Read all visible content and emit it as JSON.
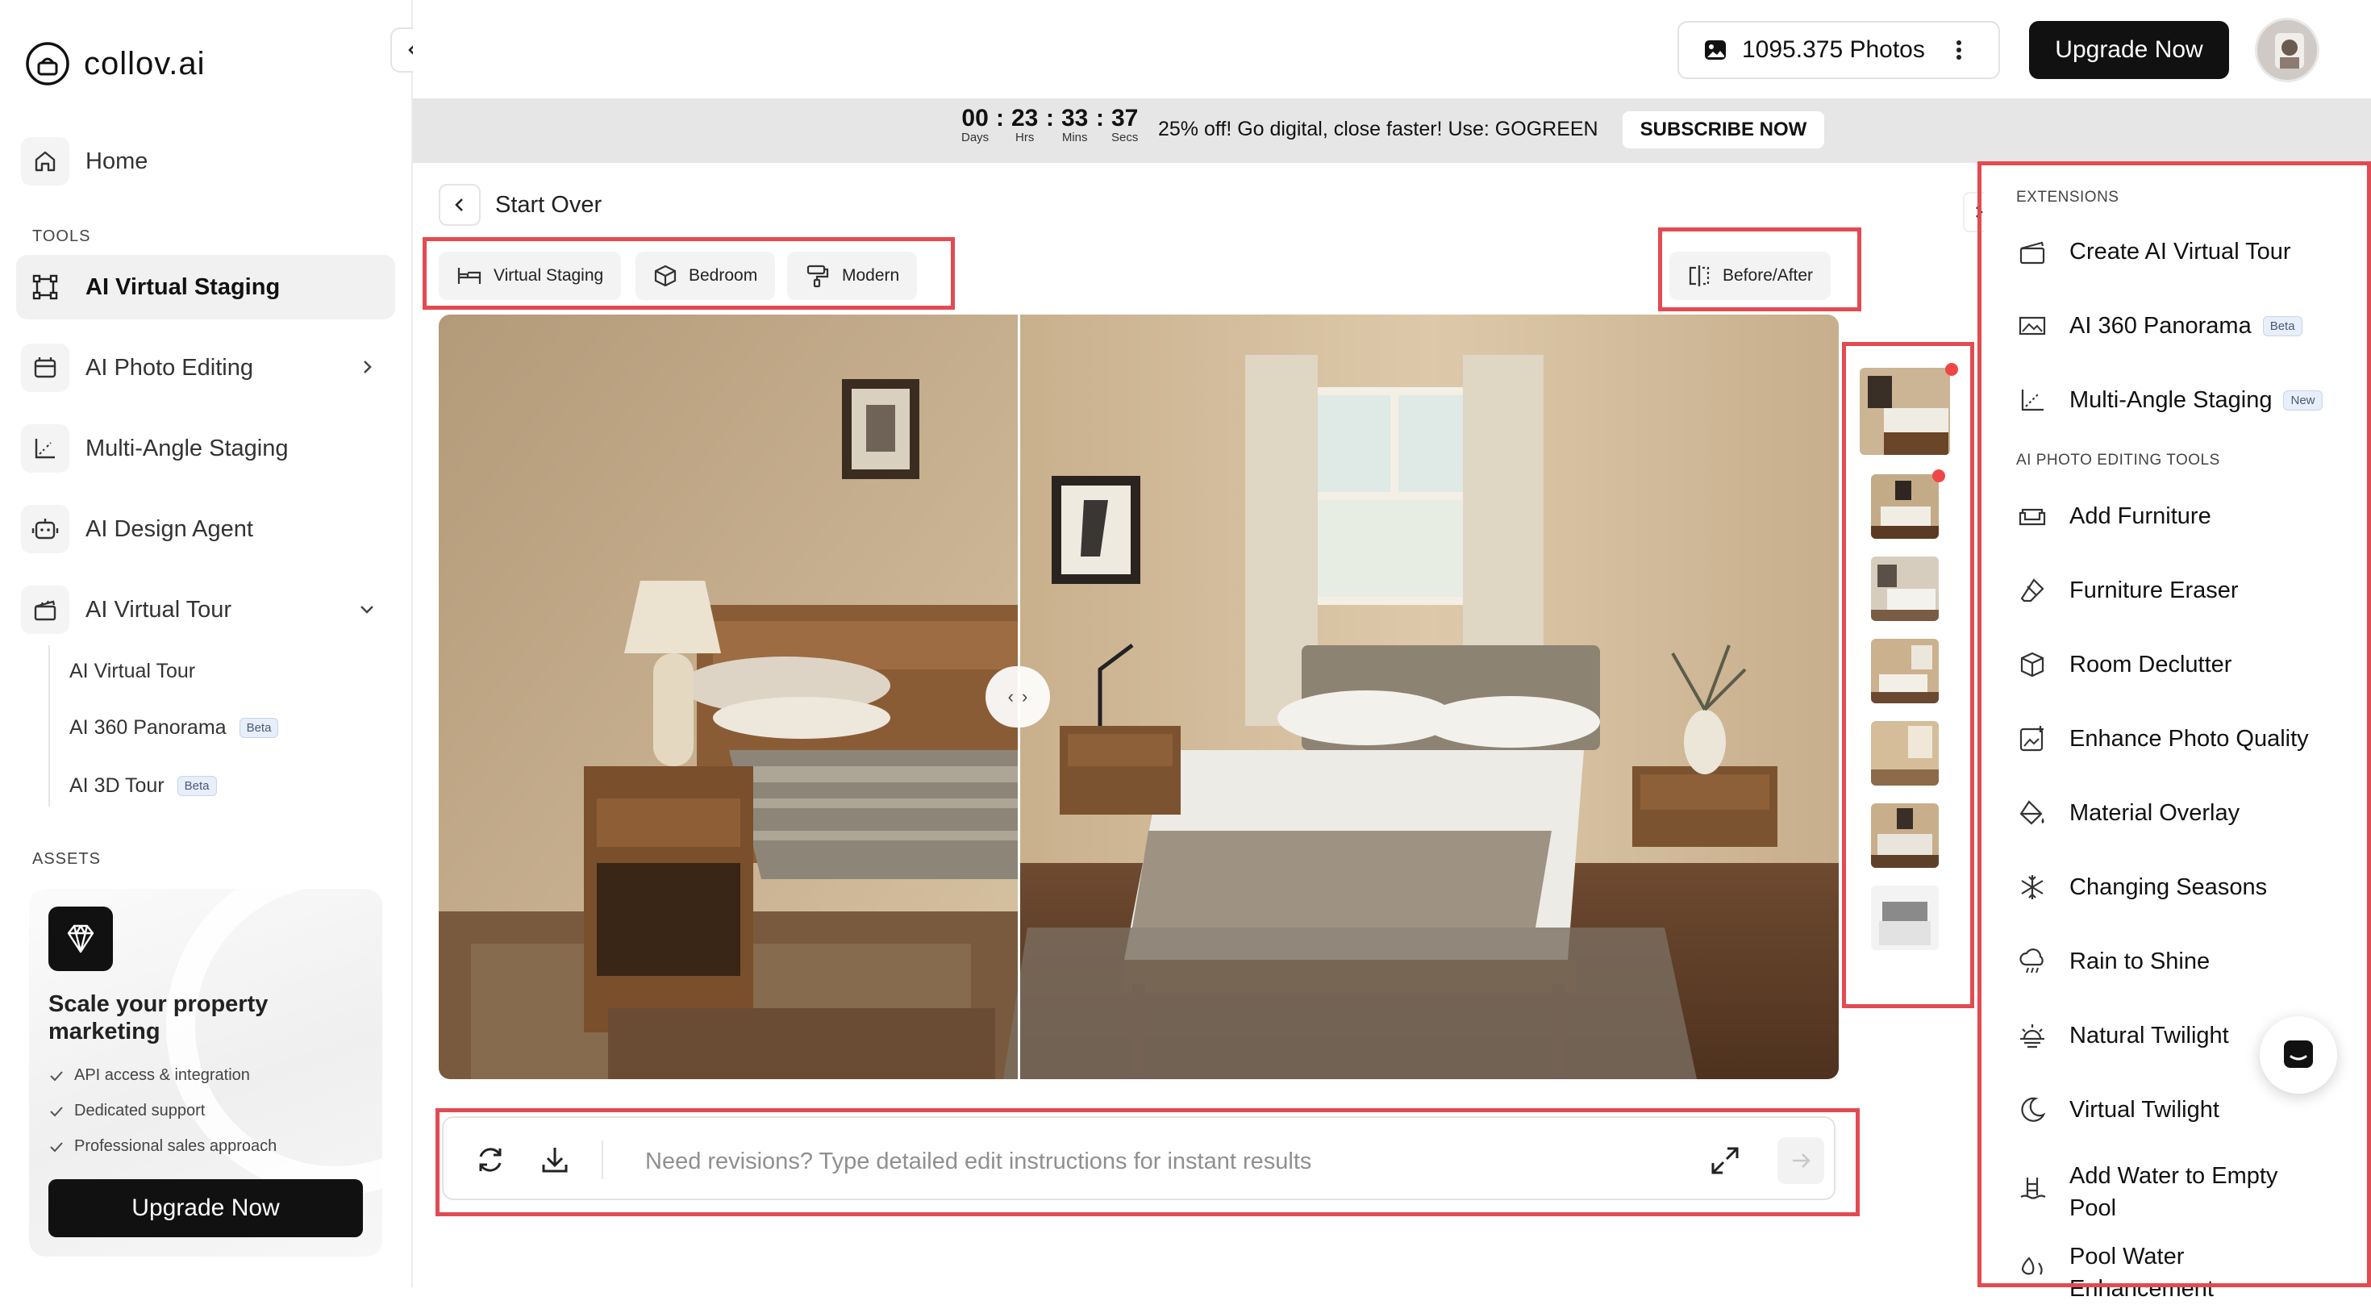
{
  "app": {
    "logo_text": "collov.ai"
  },
  "sidebar": {
    "home": "Home",
    "tools_label": "TOOLS",
    "items": [
      {
        "label": "AI Virtual Staging",
        "icon": "staging-frame-icon"
      },
      {
        "label": "AI Photo Editing",
        "icon": "photo-edit-icon"
      },
      {
        "label": "Multi-Angle Staging",
        "icon": "angle-icon"
      },
      {
        "label": "AI Design Agent",
        "icon": "agent-icon"
      },
      {
        "label": "AI Virtual Tour",
        "icon": "clapper-icon"
      }
    ],
    "subitems": [
      {
        "label": "AI Virtual Tour",
        "badge": ""
      },
      {
        "label": "AI 360 Panorama",
        "badge": "Beta"
      },
      {
        "label": "AI 3D Tour",
        "badge": "Beta"
      }
    ],
    "assets_label": "ASSETS",
    "promo": {
      "title": "Scale your property marketing",
      "features": [
        "API access & integration",
        "Dedicated support",
        "Professional sales approach"
      ],
      "button": "Upgrade Now"
    }
  },
  "topbar": {
    "photos": "1095.375 Photos",
    "upgrade": "Upgrade Now"
  },
  "banner": {
    "days": "00",
    "hrs": "23",
    "mins": "33",
    "secs": "37",
    "days_label": "Days",
    "hrs_label": "Hrs",
    "mins_label": "Mins",
    "secs_label": "Secs",
    "text": "25% off! Go digital, close faster! Use: GOGREEN",
    "button": "SUBSCRIBE NOW"
  },
  "main": {
    "back_label": "Start Over",
    "tags": [
      "Virtual Staging",
      "Bedroom",
      "Modern"
    ],
    "before_after": "Before/After",
    "prompt_placeholder": "Need revisions? Type detailed edit instructions for instant results"
  },
  "right_panel": {
    "extensions_label": "EXTENSIONS",
    "extensions": [
      {
        "label": "Create AI Virtual Tour",
        "badge": ""
      },
      {
        "label": "AI 360 Panorama",
        "badge": "Beta"
      },
      {
        "label": "Multi-Angle Staging",
        "badge": "New"
      }
    ],
    "tools_label": "AI PHOTO EDITING TOOLS",
    "tools": [
      {
        "label": "Add Furniture"
      },
      {
        "label": "Furniture Eraser"
      },
      {
        "label": "Room Declutter"
      },
      {
        "label": "Enhance Photo Quality"
      },
      {
        "label": "Material Overlay"
      },
      {
        "label": "Changing Seasons"
      },
      {
        "label": "Rain to Shine"
      },
      {
        "label": "Natural Twilight"
      },
      {
        "label": "Virtual Twilight"
      },
      {
        "label": "Add Water to Empty",
        "label2": "Pool"
      },
      {
        "label": "Pool Water",
        "label2": "Enhancement"
      }
    ]
  },
  "colors": {
    "accent": "#111111",
    "highlight": "#e24b51",
    "badge_bg": "#e8eefa"
  }
}
